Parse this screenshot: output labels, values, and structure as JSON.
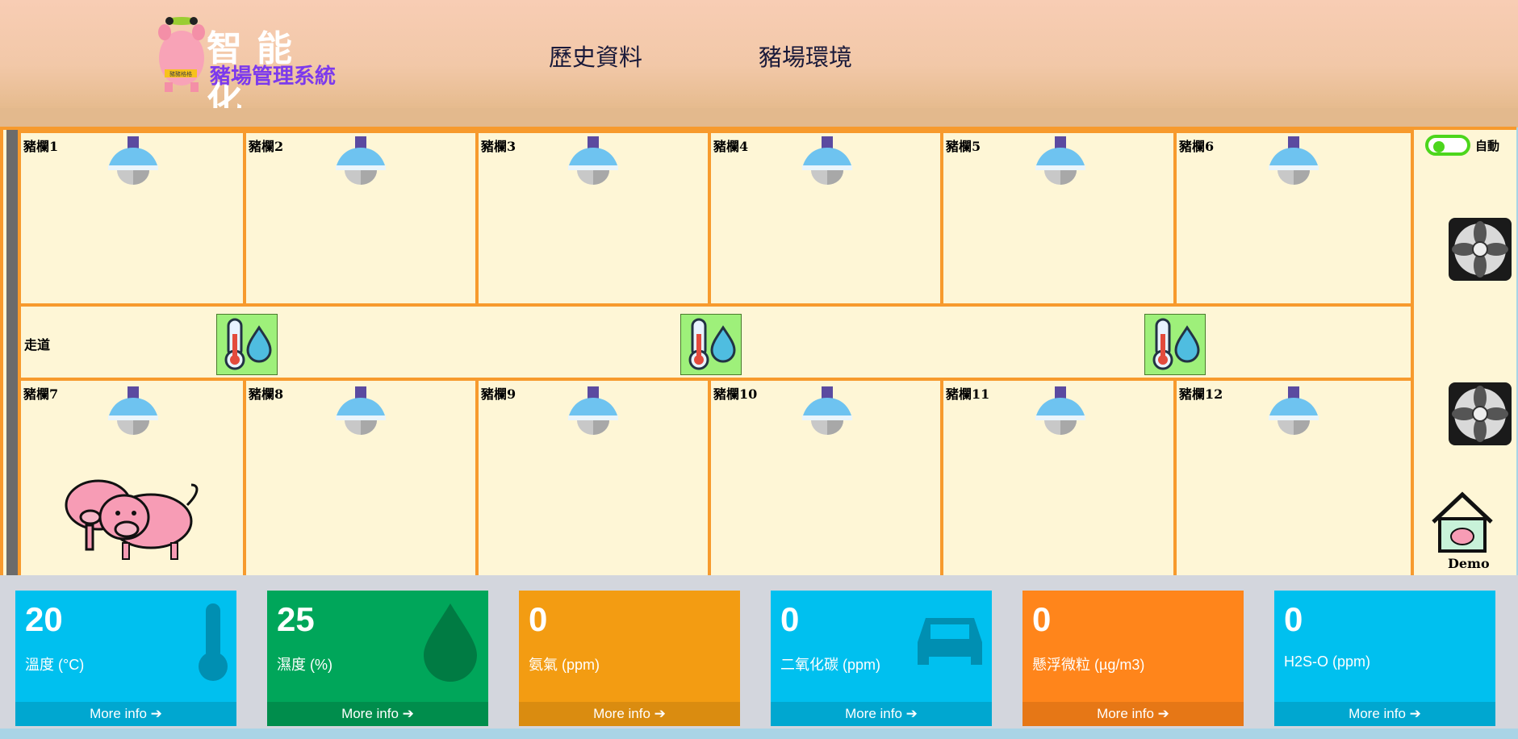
{
  "header": {
    "logo_title": "智能化",
    "logo_subtitle": "豬場管理系統",
    "logo_badge": "豬豬格格",
    "nav": [
      {
        "label": "歷史資料"
      },
      {
        "label": "豬場環境"
      }
    ]
  },
  "farm": {
    "pens_top": [
      "豬欄1",
      "豬欄2",
      "豬欄3",
      "豬欄4",
      "豬欄5",
      "豬欄6"
    ],
    "pens_bottom": [
      "豬欄7",
      "豬欄8",
      "豬欄9",
      "豬欄10",
      "豬欄11",
      "豬欄12"
    ],
    "corridor_label": "走道",
    "auto_label": "自動",
    "demo_label": "Demo"
  },
  "cards": [
    {
      "value": "20",
      "label": "溫度 (°C)",
      "footer": "More info",
      "color": "#00c0ef",
      "footer_color": "#00a7d0",
      "icon": "thermometer-icon"
    },
    {
      "value": "25",
      "label": "濕度 (%)",
      "footer": "More info",
      "color": "#00a65a",
      "footer_color": "#008d4c",
      "icon": "droplet-icon"
    },
    {
      "value": "0",
      "label": "氨氣 (ppm)",
      "footer": "More info",
      "color": "#f39c12",
      "footer_color": "#da8c10",
      "icon": ""
    },
    {
      "value": "0",
      "label": "二氧化碳 (ppm)",
      "footer": "More info",
      "color": "#00c0ef",
      "footer_color": "#00a7d0",
      "icon": "car-icon"
    },
    {
      "value": "0",
      "label": "懸浮微粒 (µg/m3)",
      "footer": "More info",
      "color": "#ff851b",
      "footer_color": "#e67716",
      "icon": ""
    },
    {
      "value": "0",
      "label": "H2S-O (ppm)",
      "footer": "More info",
      "color": "#00c0ef",
      "footer_color": "#00a7d0",
      "icon": ""
    }
  ]
}
